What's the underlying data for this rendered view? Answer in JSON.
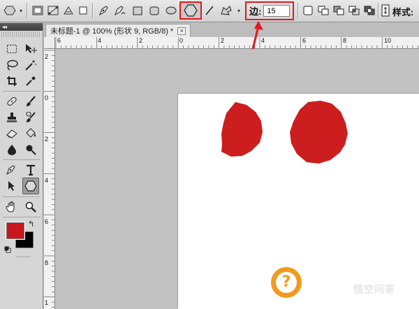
{
  "options_bar": {
    "sides_label": "边:",
    "sides_value": "15",
    "style_label": "样式:",
    "active_shape": "polygon-tool-icon"
  },
  "document_tab": {
    "title": "未标题-1 @ 100% (形状 9, RGB/8) *",
    "close_glyph": "×"
  },
  "tools_panel": {
    "collapse_glyph": "◂◂",
    "active_tool": "polygon-tool-icon"
  },
  "ruler_h_labels": [
    "6",
    "4",
    "2",
    "0",
    "2",
    "4",
    "6",
    "8",
    "10"
  ],
  "ruler_v_labels": [
    "2",
    "0",
    "2",
    "4",
    "6",
    "8",
    "1"
  ],
  "canvas": {
    "shapes": [
      {
        "name": "polygon-shape-left",
        "sides": 15,
        "color": "#cc1e1e"
      },
      {
        "name": "polygon-shape-right",
        "sides": 15,
        "color": "#cc1e1e"
      }
    ]
  },
  "colors": {
    "foreground": "#c8161d",
    "background": "#000000",
    "highlight": "#e0191d",
    "shape_fill": "#cc1e1e"
  },
  "watermark": {
    "icon_glyph": "?",
    "text": "悟空问答"
  }
}
